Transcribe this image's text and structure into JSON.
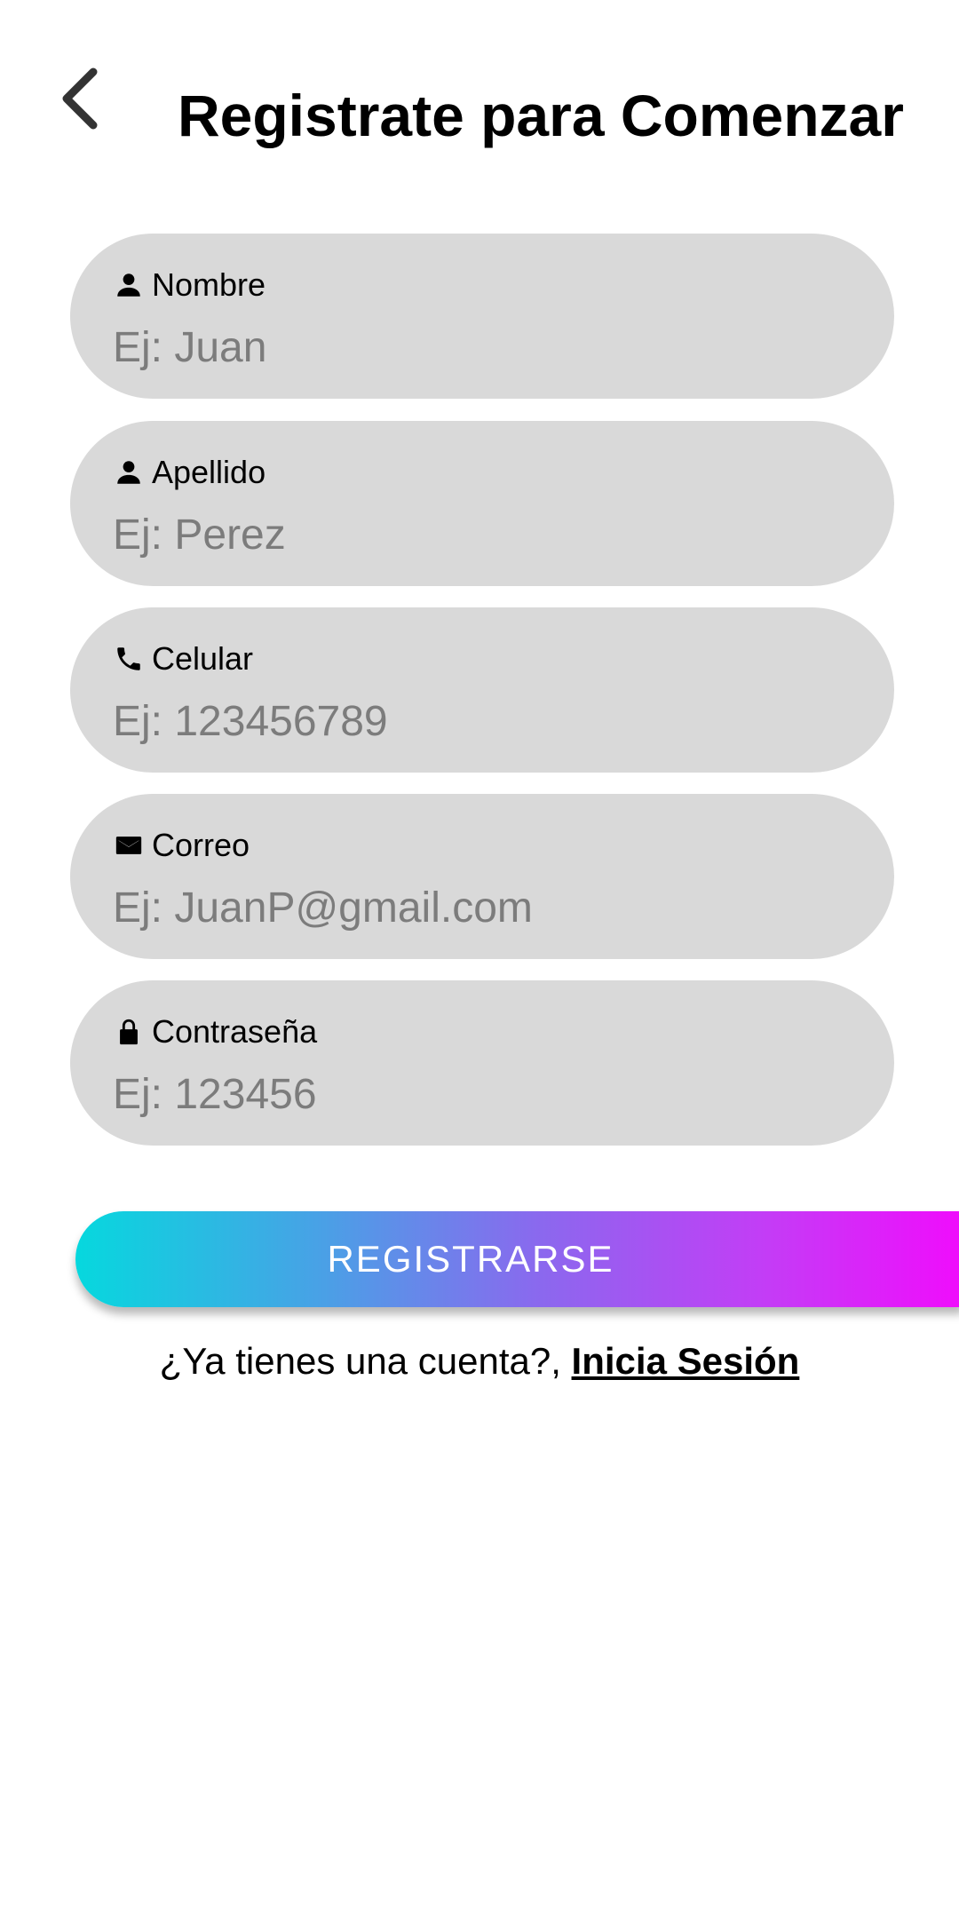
{
  "header": {
    "title": "Registrate para Comenzar",
    "back_icon": "chevron-left-icon"
  },
  "form": {
    "fields": [
      {
        "label": "Nombre",
        "placeholder": "Ej: Juan",
        "value": "",
        "icon": "person-icon"
      },
      {
        "label": "Apellido",
        "placeholder": "Ej: Perez",
        "value": "",
        "icon": "person-icon"
      },
      {
        "label": "Celular",
        "placeholder": "Ej: 123456789",
        "value": "",
        "icon": "phone-icon"
      },
      {
        "label": "Correo",
        "placeholder": "Ej: JuanP@gmail.com",
        "value": "",
        "icon": "mail-icon"
      },
      {
        "label": "Contraseña",
        "placeholder": "Ej: 123456",
        "value": "",
        "icon": "lock-icon"
      }
    ],
    "submit_label": "REGISTRARSE"
  },
  "login_prompt": {
    "text": "¿Ya tienes una cuenta?, ",
    "link": "Inicia Sesión"
  },
  "colors": {
    "field_background": "#d9d9d9",
    "placeholder": "#7c7c7c",
    "gradient_start": "#06d8de",
    "gradient_end": "#f00cfc"
  }
}
